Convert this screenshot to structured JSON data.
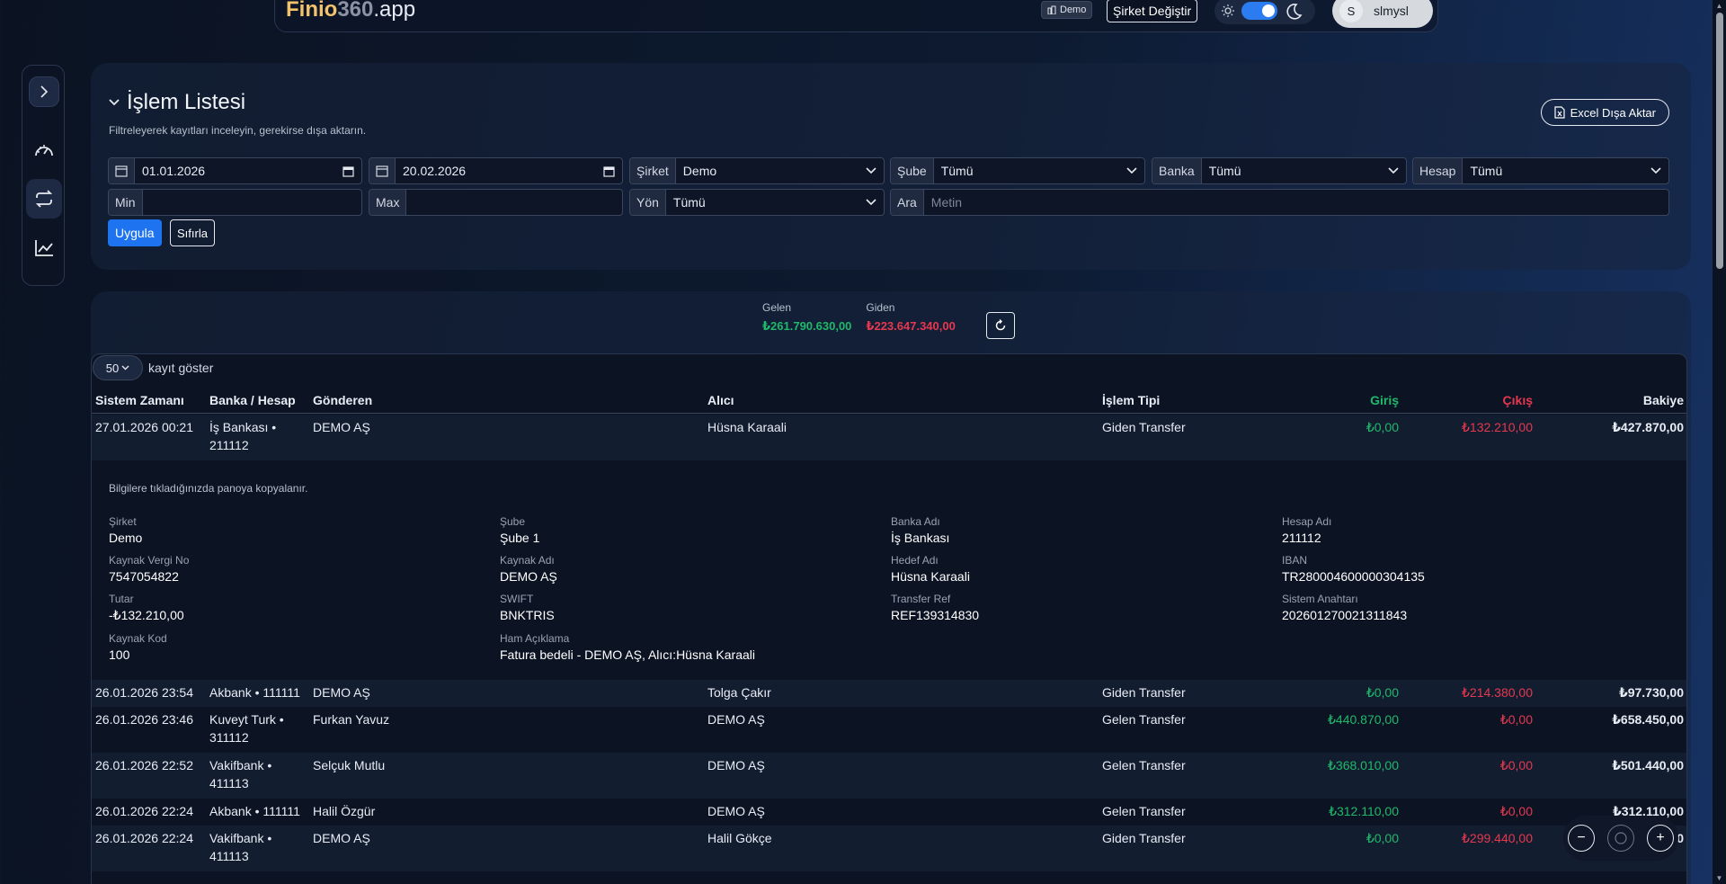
{
  "topbar": {
    "brand_part1": "Finio",
    "brand_part2": "360",
    "brand_part3": ".app",
    "demo_badge": "Demo",
    "company_switch": "Şirket Değiştir",
    "user_initial": "S",
    "user_name": "slmysl"
  },
  "filters": {
    "title": "İşlem Listesi",
    "subtitle": "Filtreleyerek kayıtları inceleyin, gerekirse dışa aktarın.",
    "export_label": "Excel Dışa Aktar",
    "date_from": "01.01.2026",
    "date_to": "20.02.2026",
    "company_label": "Şirket",
    "company_value": "Demo",
    "branch_label": "Şube",
    "branch_value": "Tümü",
    "bank_label": "Banka",
    "bank_value": "Tümü",
    "account_label": "Hesap",
    "account_value": "Tümü",
    "min_label": "Min",
    "max_label": "Max",
    "direction_label": "Yön",
    "direction_value": "Tümü",
    "search_label": "Ara",
    "search_placeholder": "Metin",
    "apply_label": "Uygula",
    "reset_label": "Sıfırla"
  },
  "totals": {
    "incoming_label": "Gelen",
    "incoming_value": "₺261.790.630,00",
    "outgoing_label": "Giden",
    "outgoing_value": "₺223.647.340,00"
  },
  "table": {
    "page_length": "50",
    "page_length_suffix": "kayıt göster",
    "headers": {
      "time": "Sistem Zamanı",
      "bank": "Banka / Hesap",
      "from": "Gönderen",
      "to": "Alıcı",
      "type": "İşlem Tipi",
      "in": "Giriş",
      "out": "Çıkış",
      "balance": "Bakiye"
    },
    "rows": [
      {
        "time": "27.01.2026 00:21",
        "bank": "İş Bankası • 211112",
        "from": "DEMO AŞ",
        "to": "Hüsna Karaali",
        "type": "Giden Transfer",
        "in": "₺0,00",
        "out": "₺132.210,00",
        "balance": "₺427.870,00"
      },
      {
        "time": "26.01.2026 23:54",
        "bank": "Akbank • 111111",
        "from": "DEMO AŞ",
        "to": "Tolga Çakır",
        "type": "Giden Transfer",
        "in": "₺0,00",
        "out": "₺214.380,00",
        "balance": "₺97.730,00"
      },
      {
        "time": "26.01.2026 23:46",
        "bank": "Kuveyt Turk • 311112",
        "from": "Furkan Yavuz",
        "to": "DEMO AŞ",
        "type": "Gelen Transfer",
        "in": "₺440.870,00",
        "out": "₺0,00",
        "balance": "₺658.450,00"
      },
      {
        "time": "26.01.2026 22:52",
        "bank": "Vakifbank • 411113",
        "from": "Selçuk Mutlu",
        "to": "DEMO AŞ",
        "type": "Gelen Transfer",
        "in": "₺368.010,00",
        "out": "₺0,00",
        "balance": "₺501.440,00"
      },
      {
        "time": "26.01.2026 22:24",
        "bank": "Akbank • 111111",
        "from": "Halil Özgür",
        "to": "DEMO AŞ",
        "type": "Gelen Transfer",
        "in": "₺312.110,00",
        "out": "₺0,00",
        "balance": "₺312.110,00"
      },
      {
        "time": "26.01.2026 22:24",
        "bank": "Vakifbank • 411113",
        "from": "DEMO AŞ",
        "to": "Halil Gökçe",
        "type": "Giden Transfer",
        "in": "₺0,00",
        "out": "₺299.440,00",
        "balance": "₺0,00"
      }
    ],
    "detail": {
      "hint": "Bilgilere tıkladığınızda panoya kopyalanır.",
      "company_label": "Şirket",
      "company": "Demo",
      "branch_label": "Şube",
      "branch": "Şube 1",
      "bank_label": "Banka Adı",
      "bank": "İş Bankası",
      "account_label": "Hesap Adı",
      "account": "211112",
      "tax_label": "Kaynak Vergi No",
      "tax": "7547054822",
      "source_label": "Kaynak Adı",
      "source": "DEMO AŞ",
      "target_label": "Hedef Adı",
      "target": "Hüsna Karaali",
      "iban_label": "IBAN",
      "iban": "TR280004600000304135",
      "amount_label": "Tutar",
      "amount": "-₺132.210,00",
      "swift_label": "SWIFT",
      "swift": "BNKTRIS",
      "ref_label": "Transfer Ref",
      "ref": "REF139314830",
      "syskey_label": "Sistem Anahtarı",
      "syskey": "202601270021311843",
      "code_label": "Kaynak Kod",
      "code": "100",
      "raw_label": "Ham Açıklama",
      "raw": "Fatura bedeli - DEMO AŞ, Alıcı:Hüsna Karaali"
    }
  },
  "zoom": {
    "minus": "−",
    "plus": "+"
  },
  "colors": {
    "accent": "#1e74f0",
    "positive": "#20b86a",
    "negative": "#e5384f",
    "brand": "#f3c36b"
  }
}
